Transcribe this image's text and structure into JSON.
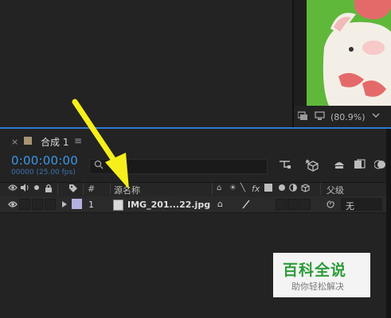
{
  "viewer": {
    "zoom": "(80.9%)",
    "icons": [
      "camera-icon",
      "monitor-icon"
    ]
  },
  "comp_tab": {
    "close": "×",
    "title": "合成 1",
    "menu": "≡"
  },
  "time": {
    "timecode": "0:00:00:00",
    "frames": "00000 (25.00 fps)"
  },
  "search": {
    "placeholder": ""
  },
  "columns": {
    "number": "#",
    "source_name": "源名称",
    "parent": "父级"
  },
  "layer": {
    "number": "1",
    "name": "IMG_201...22.jpg",
    "parent": "无",
    "label_color": "#b4b0e0"
  },
  "watermark": {
    "title": "百科全说",
    "subtitle": "助你轻松解决"
  },
  "colors": {
    "accent": "#2f78d2",
    "timecode": "#3b97e8",
    "arrow": "#f7ef1b"
  }
}
